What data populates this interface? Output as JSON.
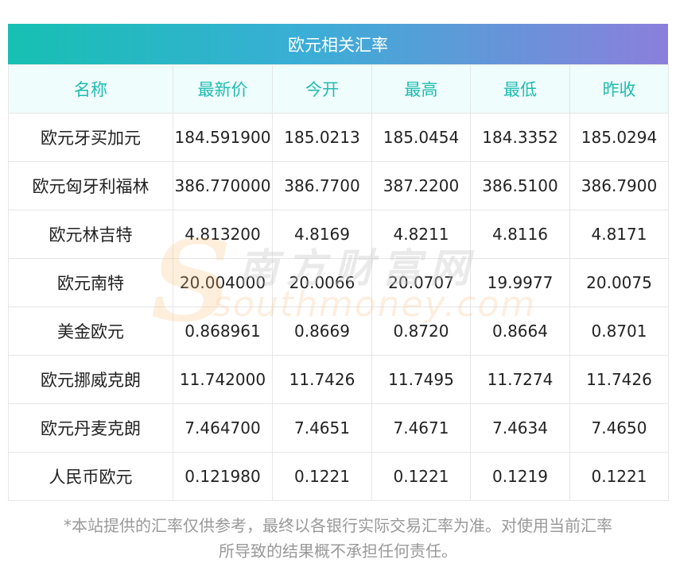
{
  "header": {
    "title": "欧元相关汇率"
  },
  "table": {
    "columns": [
      "名称",
      "最新价",
      "今开",
      "最高",
      "最低",
      "昨收"
    ],
    "rows": [
      [
        "欧元牙买加元",
        "184.591900",
        "185.0213",
        "185.0454",
        "184.3352",
        "185.0294"
      ],
      [
        "欧元匈牙利福林",
        "386.770000",
        "386.7700",
        "387.2200",
        "386.5100",
        "386.7900"
      ],
      [
        "欧元林吉特",
        "4.813200",
        "4.8169",
        "4.8211",
        "4.8116",
        "4.8171"
      ],
      [
        "欧元南特",
        "20.004000",
        "20.0066",
        "20.0707",
        "19.9977",
        "20.0075"
      ],
      [
        "美金欧元",
        "0.868961",
        "0.8669",
        "0.8720",
        "0.8664",
        "0.8701"
      ],
      [
        "欧元挪威克朗",
        "11.742000",
        "11.7426",
        "11.7495",
        "11.7274",
        "11.7426"
      ],
      [
        "欧元丹麦克朗",
        "7.464700",
        "7.4651",
        "7.4671",
        "7.4634",
        "7.4650"
      ],
      [
        "人民币欧元",
        "0.121980",
        "0.1221",
        "0.1221",
        "0.1219",
        "0.1221"
      ]
    ]
  },
  "watermark": {
    "cn": "南方财富网",
    "en": "southmoney.com"
  },
  "note": {
    "line1": "*本站提供的汇率仅供参考，最终以各银行实际交易汇率为准。对使用当前汇率",
    "line2": "所导致的结果概不承担任何责任。"
  },
  "colors": {
    "header_start": "#16c0b2",
    "header_end": "#8b7fdc",
    "column_text": "#1fbcb0"
  }
}
